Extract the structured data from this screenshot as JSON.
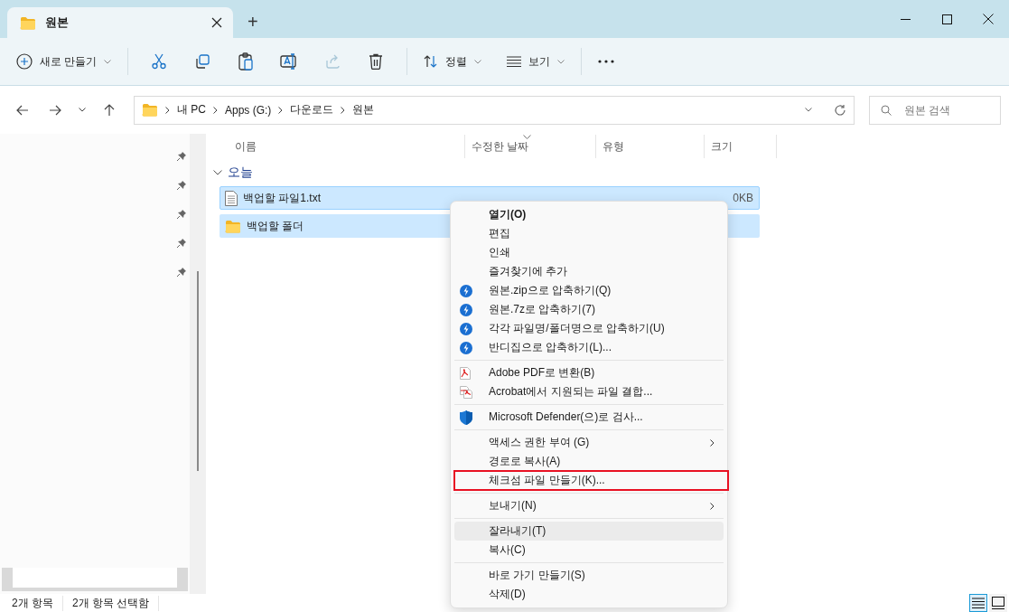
{
  "window": {
    "tab": {
      "title": "원본",
      "selected": true
    },
    "new_tab": "+"
  },
  "toolbar": {
    "new_button": "새로 만들기",
    "actions": [
      {
        "kind": "cut",
        "disabled": false
      },
      {
        "kind": "copy",
        "disabled": false
      },
      {
        "kind": "paste",
        "disabled": false
      },
      {
        "kind": "rename",
        "disabled": false
      },
      {
        "kind": "share",
        "disabled": true
      },
      {
        "kind": "delete",
        "disabled": false
      }
    ],
    "sort_button": "정렬",
    "view_button": "보기"
  },
  "address_bar": {
    "breadcrumb": [
      "내 PC",
      "Apps (G:)",
      "다운로드",
      "원본"
    ],
    "search": {
      "placeholder": "원본 검색"
    }
  },
  "file_list": {
    "columns": [
      {
        "label": "이름",
        "sorted": false
      },
      {
        "label": "수정한 날짜",
        "sorted": true
      },
      {
        "label": "유형",
        "sorted": false
      },
      {
        "label": "크기",
        "sorted": false
      }
    ],
    "group": {
      "label": "오늘",
      "expanded": true
    },
    "files": [
      {
        "name": "백업할 파일1.txt",
        "kind": "file",
        "size": "0KB",
        "selected": true,
        "focused": true
      },
      {
        "name": "백업할 폴더",
        "kind": "folder",
        "selected": true,
        "focused": false
      }
    ]
  },
  "context_menu": {
    "items": [
      {
        "kind": "item",
        "label": "열기(O)",
        "default": true
      },
      {
        "kind": "item",
        "label": "편집"
      },
      {
        "kind": "item",
        "label": "인쇄"
      },
      {
        "kind": "item",
        "label": "즐겨찾기에 추가"
      },
      {
        "kind": "archive",
        "label": "원본.zip으로 압축하기(Q)"
      },
      {
        "kind": "archive",
        "label": "원본.7z로 압축하기(7)"
      },
      {
        "kind": "archive",
        "label": "각각 파일명/폴더명으로 압축하기(U)"
      },
      {
        "kind": "archive",
        "label": "반디집으로 압축하기(L)..."
      },
      {
        "kind": "separator"
      },
      {
        "kind": "pdf",
        "label": "Adobe PDF로 변환(B)"
      },
      {
        "kind": "merge",
        "label": "Acrobat에서 지원되는 파일 결합..."
      },
      {
        "kind": "separator"
      },
      {
        "kind": "scan",
        "label": "Microsoft Defender(으)로 검사..."
      },
      {
        "kind": "separator"
      },
      {
        "kind": "item",
        "label": "액세스 권한 부여 (G)",
        "submenu": true
      },
      {
        "kind": "item",
        "label": "경로로 복사(A)"
      },
      {
        "kind": "item",
        "label": "체크섬 파일 만들기(K)...",
        "outlined": true
      },
      {
        "kind": "separator"
      },
      {
        "kind": "item",
        "label": "보내기(N)",
        "submenu": true
      },
      {
        "kind": "separator"
      },
      {
        "kind": "item",
        "label": "잘라내기(T)",
        "highlighted": true
      },
      {
        "kind": "item",
        "label": "복사(C)"
      },
      {
        "kind": "separator"
      },
      {
        "kind": "item",
        "label": "바로 가기 만들기(S)"
      },
      {
        "kind": "item",
        "label": "삭제(D)"
      }
    ]
  },
  "status_bar": {
    "items": [
      "2개 항목",
      "2개 항목 선택함"
    ],
    "views": [
      {
        "kind": "details",
        "selected": true
      },
      {
        "kind": "tiles",
        "selected": false
      }
    ]
  }
}
